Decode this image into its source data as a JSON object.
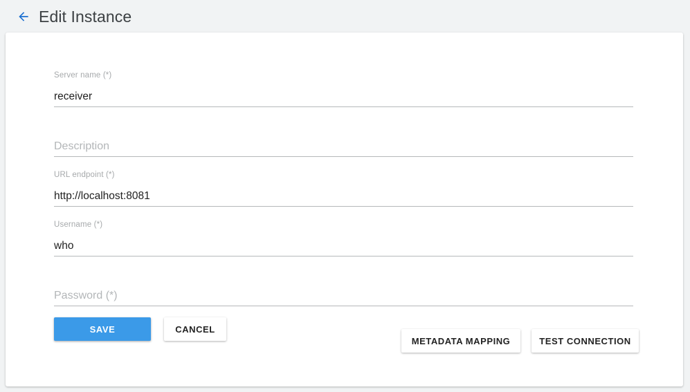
{
  "header": {
    "back_icon": "arrow-left-icon",
    "title": "Edit Instance",
    "accent_color": "#1a73e8"
  },
  "form": {
    "fields": [
      {
        "name": "server-name",
        "label": "Server name (*)",
        "value": "receiver",
        "placeholder": "Server name (*)",
        "filled": true
      },
      {
        "name": "description",
        "label": "Description",
        "value": "",
        "placeholder": "Description",
        "filled": false
      },
      {
        "name": "url-endpoint",
        "label": "URL endpoint (*)",
        "value": "http://localhost:8081",
        "placeholder": "URL endpoint (*)",
        "filled": true
      },
      {
        "name": "username",
        "label": "Username (*)",
        "value": "who",
        "placeholder": "Username (*)",
        "filled": true
      },
      {
        "name": "password",
        "label": "Password (*)",
        "value": "",
        "placeholder": "Password (*)",
        "filled": false
      }
    ]
  },
  "actions": {
    "save_label": "SAVE",
    "cancel_label": "CANCEL",
    "metadata_mapping_label": "METADATA MAPPING",
    "test_connection_label": "TEST CONNECTION",
    "primary_color": "#3b9ae8"
  }
}
